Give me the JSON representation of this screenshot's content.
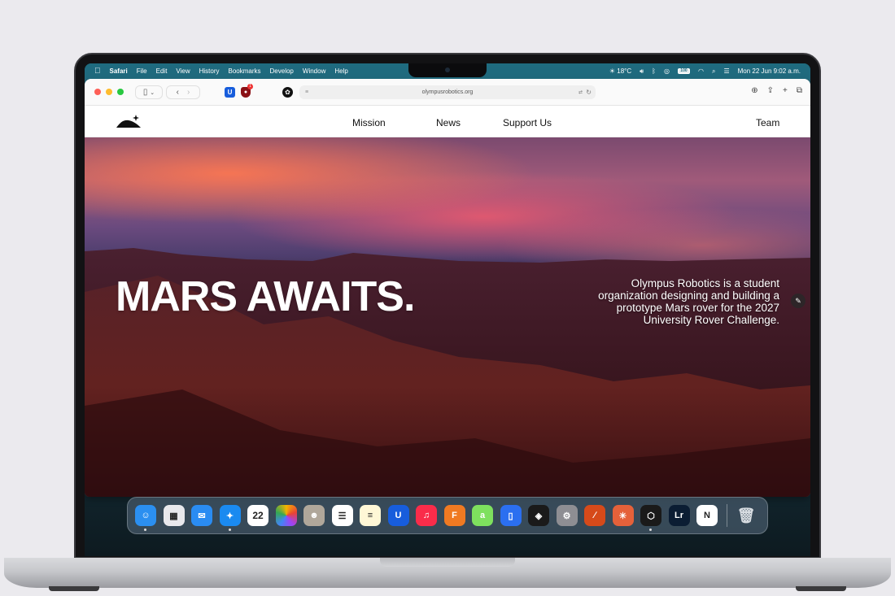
{
  "menubar": {
    "app_name": "Safari",
    "menus": [
      "File",
      "Edit",
      "View",
      "History",
      "Bookmarks",
      "Develop",
      "Window",
      "Help"
    ],
    "weather": "18°C",
    "battery": "100",
    "datetime": "Mon 22 Jun  9:02 a.m."
  },
  "browser": {
    "url": "olympusrobotics.org",
    "extension_badge": "1"
  },
  "site": {
    "nav": {
      "mission": "Mission",
      "news": "News",
      "support": "Support Us",
      "team": "Team"
    },
    "hero": {
      "title": "MARS AWAITS.",
      "description": "Olympus Robotics is a student organization designing and building a prototype Mars rover for the 2027 University Rover Challenge."
    }
  },
  "dock": {
    "calendar_day": "22",
    "apps": [
      {
        "name": "finder",
        "color": "#2b8ff0"
      },
      {
        "name": "launchpad",
        "color": "#e8e8ec"
      },
      {
        "name": "mail",
        "color": "#2a8cf2"
      },
      {
        "name": "safari",
        "color": "#1a8af0"
      },
      {
        "name": "calendar",
        "color": "#ffffff"
      },
      {
        "name": "photos",
        "color": "#ffffff"
      },
      {
        "name": "contacts",
        "color": "#b0a79a"
      },
      {
        "name": "reminders",
        "color": "#ffffff"
      },
      {
        "name": "notes",
        "color": "#fff7d6"
      },
      {
        "name": "bitwarden",
        "color": "#175ddc"
      },
      {
        "name": "music",
        "color": "#fa2c4a"
      },
      {
        "name": "fusion",
        "color": "#f07a22"
      },
      {
        "name": "affinity",
        "color": "#7ee05e"
      },
      {
        "name": "simulator",
        "color": "#2b6ff0"
      },
      {
        "name": "davinci-resolve",
        "color": "#1a1a1a"
      },
      {
        "name": "system-settings",
        "color": "#8e8e93"
      },
      {
        "name": "affinity-designer",
        "color": "#d64a1a"
      },
      {
        "name": "claude",
        "color": "#e5613a"
      },
      {
        "name": "framer",
        "color": "#1a1a1a"
      },
      {
        "name": "lightroom",
        "color": "#0b1d33"
      },
      {
        "name": "notion",
        "color": "#ffffff"
      }
    ]
  }
}
